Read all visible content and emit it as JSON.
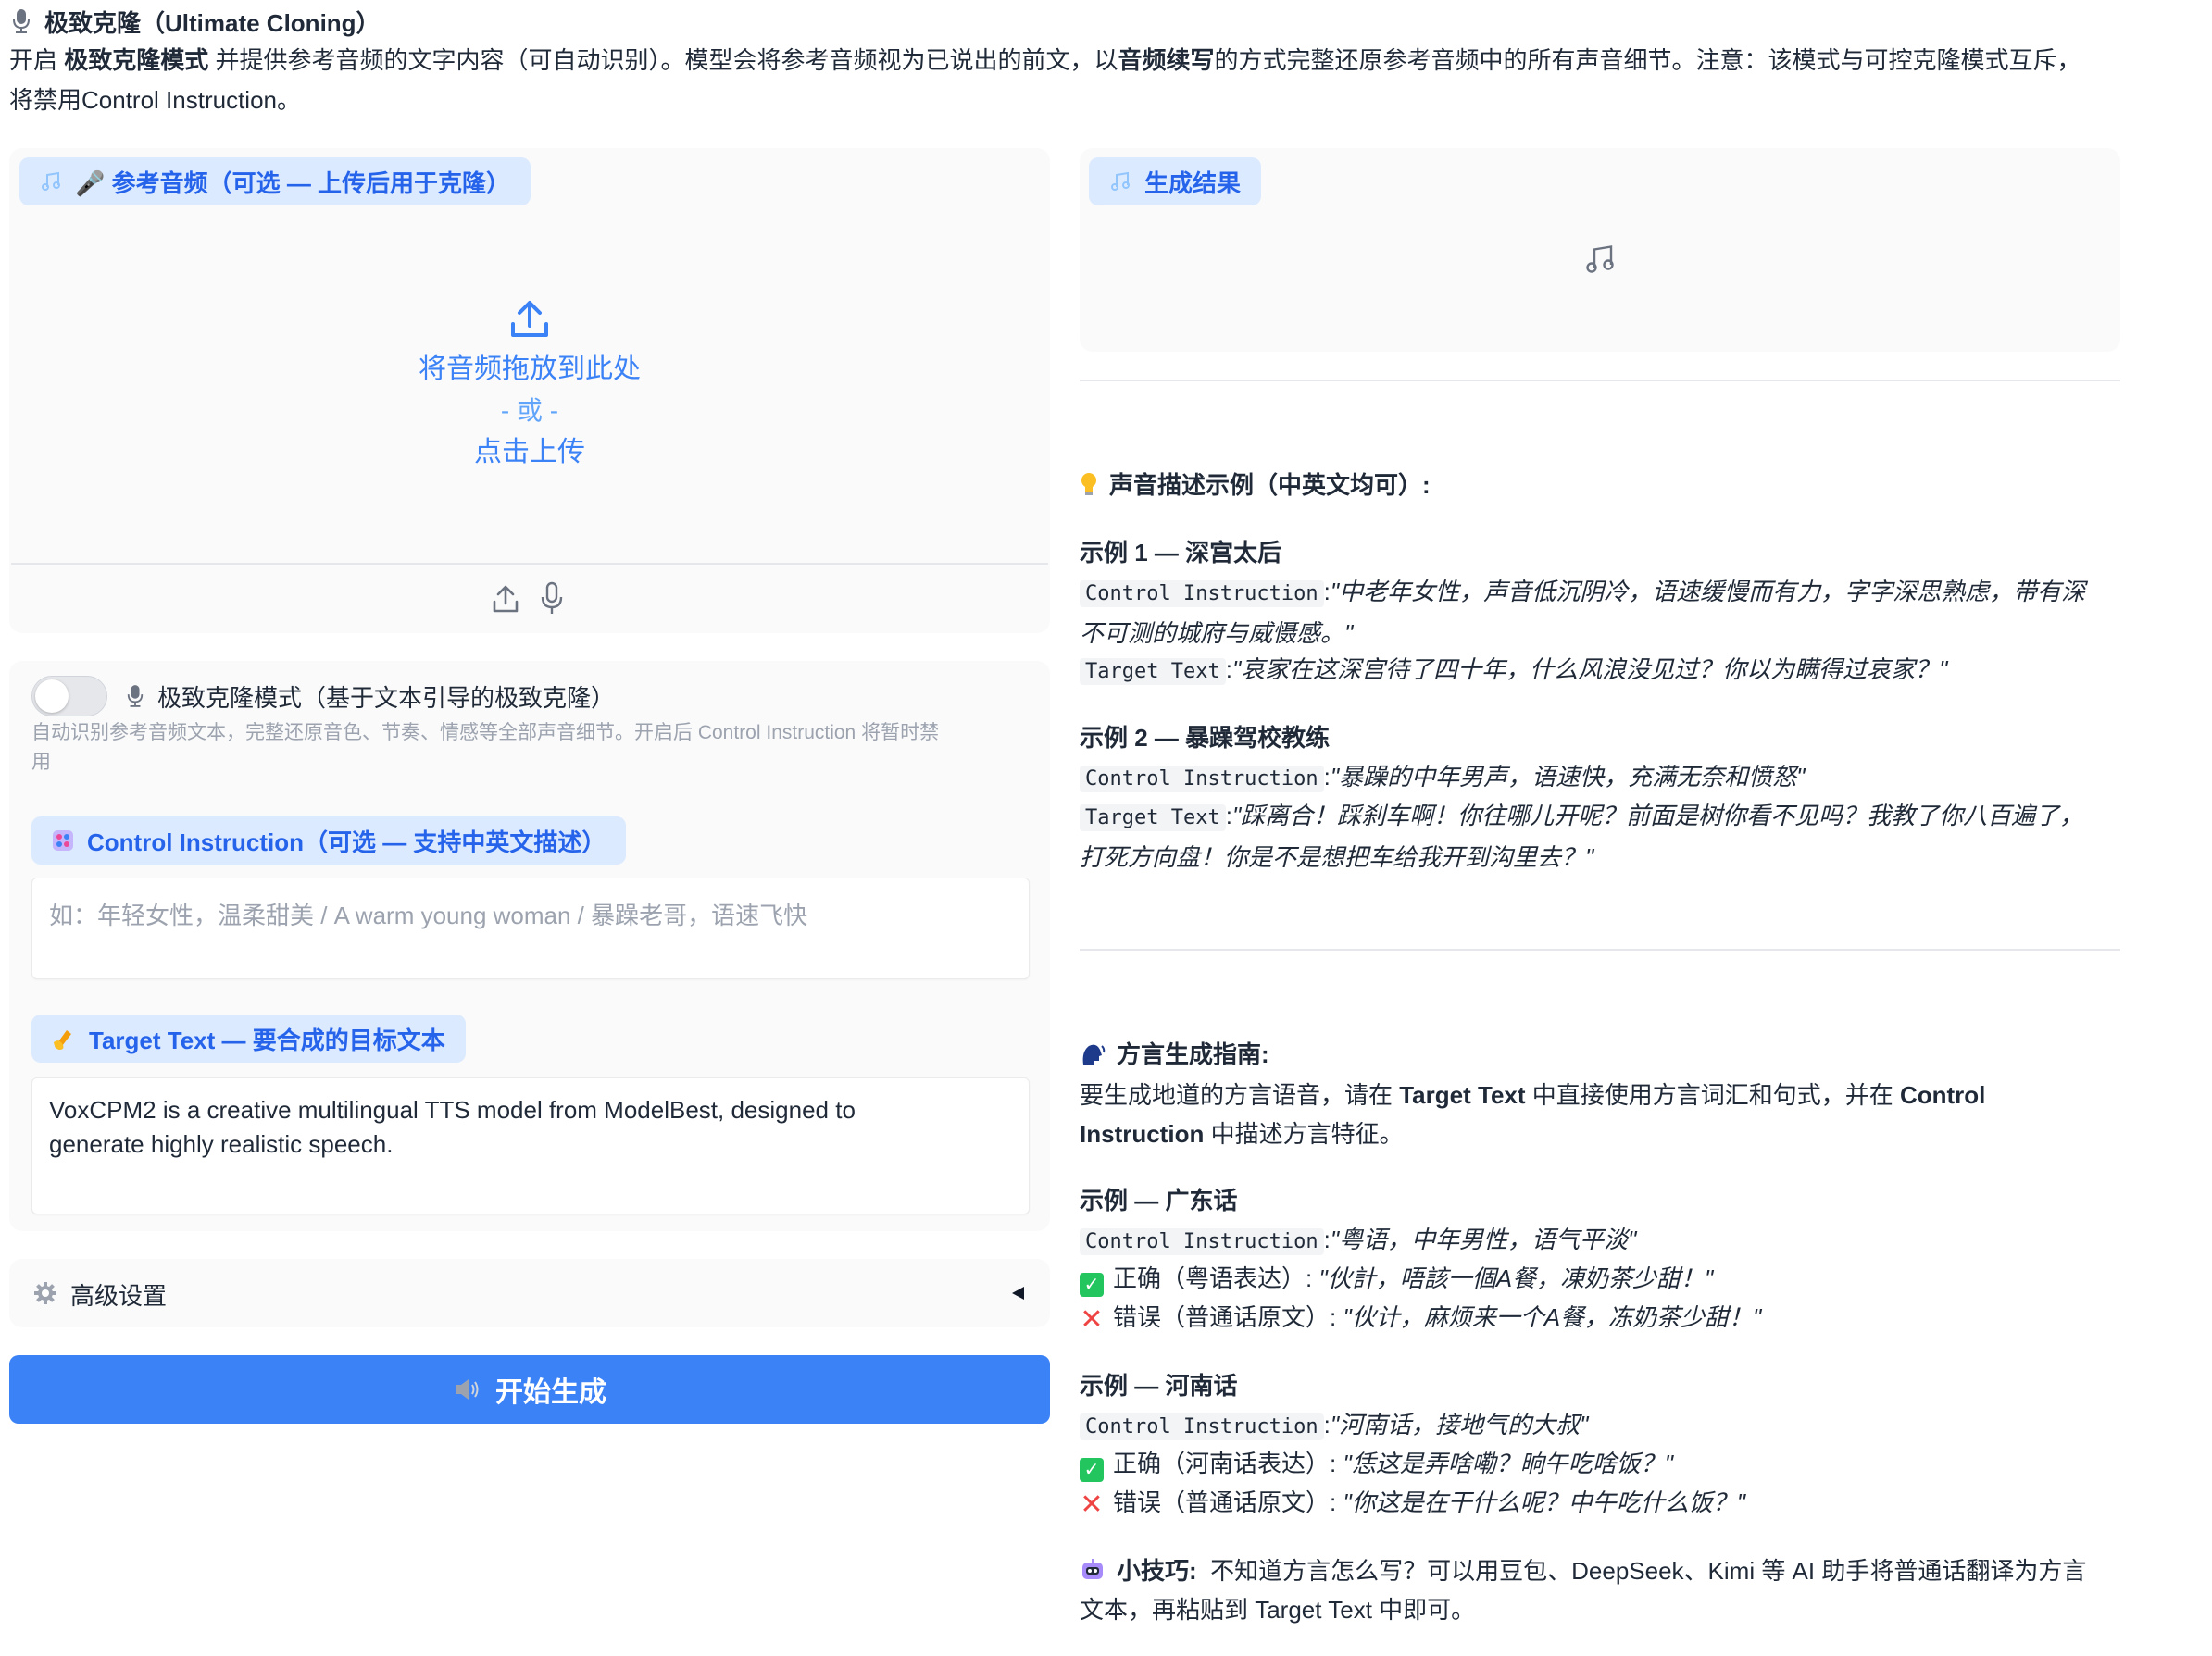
{
  "header": {
    "title": "极致克隆（Ultimate Cloning）",
    "desc_1": "开启 ",
    "desc_bold_1": "极致克隆模式",
    "desc_2": " 并提供参考音频的文字内容（可自动识别）。模型会将参考音频视为已说出的前文，以",
    "desc_bold_2": "音频续写",
    "desc_3": "的方式完整还原参考音频中的所有声音细节。注意：该模式与可控克隆模式互斥，",
    "desc_4": "将禁用Control Instruction。"
  },
  "reference_audio": {
    "label": "🎤 参考音频（可选 — 上传后用于克隆）",
    "drop_text": "将音频拖放到此处",
    "or_text": "- 或 -",
    "click_upload": "点击上传"
  },
  "ultimate_mode": {
    "label": "极致克隆模式（基于文本引导的极致克隆）",
    "enabled": false,
    "help_line1": "自动识别参考音频文本，完整还原音色、节奏、情感等全部声音细节。开启后 Control Instruction 将暂时禁",
    "help_line2": "用"
  },
  "control_instruction": {
    "label": "Control Instruction（可选 — 支持中英文描述）",
    "placeholder": "如：年轻女性，温柔甜美 / A warm young woman / 暴躁老哥，语速飞快"
  },
  "target_text": {
    "label": "Target Text — 要合成的目标文本",
    "value": "VoxCPM2 is a creative multilingual TTS model from ModelBest, designed to generate highly realistic speech."
  },
  "advanced": {
    "label": "高级设置"
  },
  "generate_button": {
    "label": "开始生成"
  },
  "result": {
    "label": "生成结果"
  },
  "examples": {
    "heading": "声音描述示例（中英文均可）:",
    "ex1_title": "示例 1 — 深宫太后",
    "ci_key": "Control Instruction",
    "tt_key": "Target Text",
    "colon": ":",
    "ex1_ci_a": "\"中老年女性，声音低沉阴冷，语速缓慢而有力，字字深思熟虑，带有深",
    "ex1_ci_b": "不可测的城府与威慑感。\"",
    "ex1_tt": "\"哀家在这深宫待了四十年，什么风浪没见过？你以为瞒得过哀家？\"",
    "ex2_title": "示例 2 — 暴躁驾校教练",
    "ex2_ci": "\"暴躁的中年男声，语速快，充满无奈和愤怒\"",
    "ex2_tt_a": "\"踩离合！踩刹车啊！你往哪儿开呢？前面是树你看不见吗？我教了你八百遍了，",
    "ex2_tt_b": "打死方向盘！你是不是想把车给我开到沟里去？\""
  },
  "dialect": {
    "heading": "方言生成指南:",
    "intro_1": "要生成地道的方言语音，请在 ",
    "intro_b1": "Target Text",
    "intro_2": " 中直接使用方言词汇和句式，并在 ",
    "intro_b2": "Control",
    "intro_b3": "Instruction",
    "intro_3": " 中描述方言特征。",
    "cantonese_title": "示例 — 广东话",
    "cantonese_ci": "\"粤语，中年男性，语气平淡\"",
    "cantonese_ok_label": "正确（粤语表达）:",
    "cantonese_ok": "\"伙計，唔該一個A餐，凍奶茶少甜！\"",
    "cantonese_bad_label": "错误（普通话原文）:",
    "cantonese_bad": "\"伙计，麻烦来一个A餐，冻奶茶少甜！\"",
    "henan_title": "示例 — 河南话",
    "henan_ci": "\"河南话，接地气的大叔\"",
    "henan_ok_label": "正确（河南话表达）:",
    "henan_ok": "\"恁这是弄啥嘞？晌午吃啥饭？\"",
    "henan_bad_label": "错误（普通话原文）:",
    "henan_bad": "\"你这是在干什么呢？中午吃什么饭？\"",
    "tip_label": "小技巧:",
    "tip_a": "不知道方言怎么写？可以用豆包、DeepSeek、Kimi 等 AI 助手将普通话翻译为方言",
    "tip_b": "文本，再粘贴到 Target Text 中即可。"
  }
}
